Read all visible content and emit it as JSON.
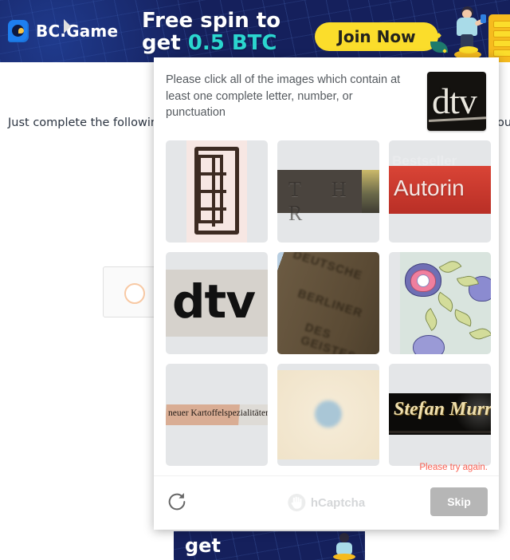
{
  "top_banner": {
    "brand_name": "BC.Game",
    "headline_line1": "Free spin to",
    "headline_line2_prefix": "get ",
    "headline_highlight": "0.5 BTC",
    "cta_label": "Join Now",
    "colors": {
      "background": "#15205c",
      "cta_bg": "#fbdd2b",
      "highlight": "#2bd6cf"
    }
  },
  "page": {
    "left_text": "Just complete the following",
    "right_text_fragment": "ou"
  },
  "bottom_banner": {
    "text": "get"
  },
  "captcha": {
    "prompt": "Please click all of the images which contain at least one complete letter, number, or punctuation",
    "example_label": "dtv",
    "tiles": [
      {
        "id": "tile-1",
        "alt": "hand-drawn window grid on pink paper",
        "text": ""
      },
      {
        "id": "tile-2",
        "alt": "embossed letters on dark metal plate",
        "text": "T H R"
      },
      {
        "id": "tile-3",
        "alt": "white text on red banner",
        "text": "Autorin"
      },
      {
        "id": "tile-4",
        "alt": "bold black logotype on grey paper",
        "text": "dtv"
      },
      {
        "id": "tile-5",
        "alt": "blurred angled stamped text on brown surface",
        "text": ""
      },
      {
        "id": "tile-6",
        "alt": "floral pattern with purple flowers and green leaves",
        "text": ""
      },
      {
        "id": "tile-7",
        "alt": "serif text on highlighted strip",
        "text": "neuer Kartoffelspezialitäten"
      },
      {
        "id": "tile-8",
        "alt": "beige surface with a blue dot",
        "text": ""
      },
      {
        "id": "tile-9",
        "alt": "gold serif name on black plaque",
        "text": "Stefan Murr"
      }
    ],
    "footer": {
      "error_message": "Please try again.",
      "brand_name": "hCaptcha",
      "skip_label": "Skip",
      "refresh_icon": "refresh-icon"
    },
    "colors": {
      "error": "#f96153",
      "skip_bg": "#b6b6b6",
      "tile_bg": "#e4e6e8"
    }
  }
}
